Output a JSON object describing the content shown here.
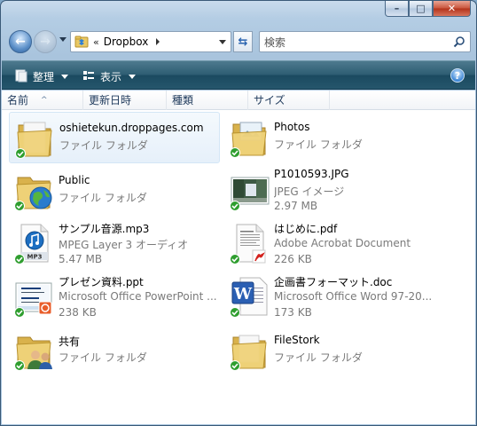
{
  "window": {
    "caption_buttons": {
      "minimize": "–",
      "maximize": "□",
      "close": "✕"
    }
  },
  "address_bar": {
    "back_glyph": "←",
    "forward_glyph": "→",
    "crumb_separator": "«",
    "location": "Dropbox",
    "refresh_glyph": "⇆"
  },
  "search": {
    "placeholder": "検索"
  },
  "toolbar": {
    "organize_label": "整理",
    "views_label": "表示",
    "help_glyph": "?"
  },
  "columns": [
    "名前",
    "更新日時",
    "種類",
    "サイズ"
  ],
  "items": [
    {
      "name": "oshietekun.droppages.com",
      "type": "ファイル フォルダ",
      "size": "",
      "icon": "folder-icon",
      "selected": true
    },
    {
      "name": "Photos",
      "type": "ファイル フォルダ",
      "size": "",
      "icon": "photos-folder-icon"
    },
    {
      "name": "Public",
      "type": "ファイル フォルダ",
      "size": "",
      "icon": "public-folder-icon"
    },
    {
      "name": "P1010593.JPG",
      "type": "JPEG イメージ",
      "size": "2.97 MB",
      "icon": "jpeg-thumbnail-icon"
    },
    {
      "name": "サンプル音源.mp3",
      "type": "MPEG Layer 3 オーディオ",
      "size": "5.47 MB",
      "icon": "mp3-file-icon",
      "icon_text": "MP3"
    },
    {
      "name": "はじめに.pdf",
      "type": "Adobe Acrobat Document",
      "size": "226 KB",
      "icon": "pdf-file-icon"
    },
    {
      "name": "プレゼン資料.ppt",
      "type": "Microsoft Office PowerPoint ...",
      "size": "238 KB",
      "icon": "ppt-file-icon"
    },
    {
      "name": "企画書フォーマット.doc",
      "type": "Microsoft Office Word 97-20...",
      "size": "173 KB",
      "icon": "word-file-icon",
      "icon_text": "W"
    },
    {
      "name": "共有",
      "type": "ファイル フォルダ",
      "size": "",
      "icon": "shared-folder-icon"
    },
    {
      "name": "FileStork",
      "type": "ファイル フォルダ",
      "size": "",
      "icon": "folder-icon"
    }
  ],
  "colors": {
    "toolbar": "#2e5d73",
    "sync_ok": "#2f9e2f",
    "selection": "#e6f0fa"
  }
}
